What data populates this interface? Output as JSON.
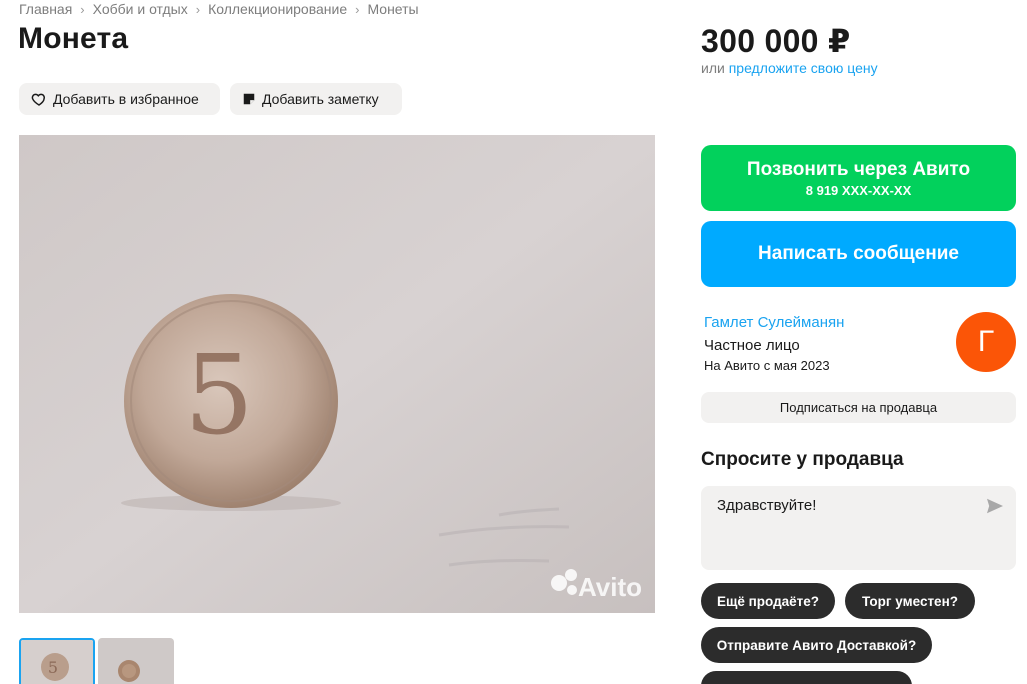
{
  "breadcrumbs": [
    "Главная",
    "Хобби и отдых",
    "Коллекционирование",
    "Монеты"
  ],
  "title": "Монета",
  "actions": {
    "favorite_label": "Добавить в избранное",
    "note_label": "Добавить заметку"
  },
  "gallery": {
    "watermark": "Avito",
    "coin_digit": "5"
  },
  "price": {
    "value": "300 000 ₽",
    "or_text": "или",
    "offer_link": "предложите свою цену"
  },
  "contact": {
    "call_label": "Позвонить через Авито",
    "phone_masked": "8 919 XXX-XX-XX",
    "message_label": "Написать сообщение"
  },
  "seller": {
    "name": "Гамлет Сулейманян",
    "type": "Частное лицо",
    "since": "На Авито с мая 2023",
    "avatar_letter": "Г",
    "avatar_color": "#fb5507",
    "subscribe_label": "Подписаться на продавца"
  },
  "ask": {
    "title": "Спросите у продавца",
    "message": "Здравствуйте!",
    "quick_questions": [
      "Ещё продаёте?",
      "Торг уместен?",
      "Отправите Авито Доставкой?"
    ]
  },
  "colors": {
    "accent_blue": "#00aaff",
    "call_green": "#02d15c",
    "link_blue": "#1aa3f0"
  }
}
